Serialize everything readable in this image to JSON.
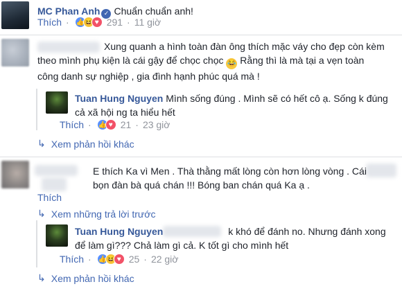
{
  "comment1": {
    "author": "MC Phan Anh",
    "text": "Chuẩn chuẩn anh!",
    "like_label": "Thích",
    "count": "291",
    "time": "11 giờ"
  },
  "comment2": {
    "text_line1": "Xung quanh a hình toàn đàn ông thích mặc váy cho đẹp còn kèm",
    "text_line2": "theo mình phụ kiện là cái gậy để chọc chọc",
    "text_line2b": "Rằng thì là mà tại a vẹn toàn",
    "text_line3": "công danh sự nghiệp , gia đình hạnh phúc quá mà !",
    "reply": {
      "author": "Tuan Hung Nguyen",
      "text_line1": "Mình sống đúng . Mình sẽ có hết cô ạ. Sống k đúng",
      "text_line2": "cả xã hội ng ta hiểu hết",
      "like_label": "Thích",
      "count": "21",
      "time": "23 giờ"
    },
    "more_replies": "Xem phản hồi khác"
  },
  "comment3": {
    "text_line1": "E thích Ka vì Men . Thà thằng mất lòng còn hơn lòng vòng . Cái",
    "text_line2": "bọn đàn bà quá chán !!! Bóng ban chán quá Ka ạ .",
    "like_label": "Thích",
    "previous_replies": "Xem những trả lời trước",
    "reply": {
      "author": "Tuan Hung Nguyen",
      "text_line1": "k khó để đánh no. Nhưng đánh xong",
      "text_line2": "để làm gì??? Chả làm gì cả. K tốt gì cho mình hết",
      "like_label": "Thích",
      "count": "25",
      "time": "22 giờ"
    },
    "more_replies": "Xem phản hồi khác"
  }
}
